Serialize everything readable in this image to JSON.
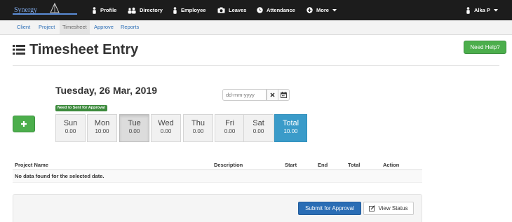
{
  "nav": {
    "brand": "Synergy",
    "items": [
      {
        "label": "Profile",
        "icon": "user-icon"
      },
      {
        "label": "Directory",
        "icon": "users-icon"
      },
      {
        "label": "Employee",
        "icon": "user-icon"
      },
      {
        "label": "Leaves",
        "icon": "camera-icon"
      },
      {
        "label": "Attendance",
        "icon": "clock-icon"
      },
      {
        "label": "More",
        "icon": "plus-circle-icon"
      }
    ],
    "user": "Alka P"
  },
  "subnav": {
    "items": [
      "Client",
      "Project",
      "Timesheet",
      "Approve",
      "Reports"
    ],
    "active": "Timesheet"
  },
  "page": {
    "title": "Timesheet Entry",
    "help_label": "Need Help?"
  },
  "entry": {
    "date_heading": "Tuesday, 26 Mar, 2019",
    "status_badge": "Need to Sent for Approval",
    "date_placeholder": "dd-mm-yyyy"
  },
  "week": {
    "days": [
      {
        "name": "Sun",
        "hours": "0.00"
      },
      {
        "name": "Mon",
        "hours": "10:00"
      },
      {
        "name": "Tue",
        "hours": "0.00"
      },
      {
        "name": "Wed",
        "hours": "0.00"
      },
      {
        "name": "Thu",
        "hours": "0.00"
      },
      {
        "name": "Fri",
        "hours": "0.00"
      },
      {
        "name": "Sat",
        "hours": "0.00"
      }
    ],
    "selected": "Tue",
    "total": {
      "name": "Total",
      "hours": "10.00"
    }
  },
  "table": {
    "columns": [
      "Project Name",
      "Description",
      "Start",
      "End",
      "Total",
      "Action"
    ],
    "empty_message": "No data found for the selected date."
  },
  "actions": {
    "submit_label": "Submit for Approval",
    "view_status_label": "View Status"
  },
  "colors": {
    "topbar": "#1c1c1c",
    "success_green": "#4cae4c",
    "primary_blue": "#2a6db5",
    "total_blue": "#3a9bc9"
  }
}
